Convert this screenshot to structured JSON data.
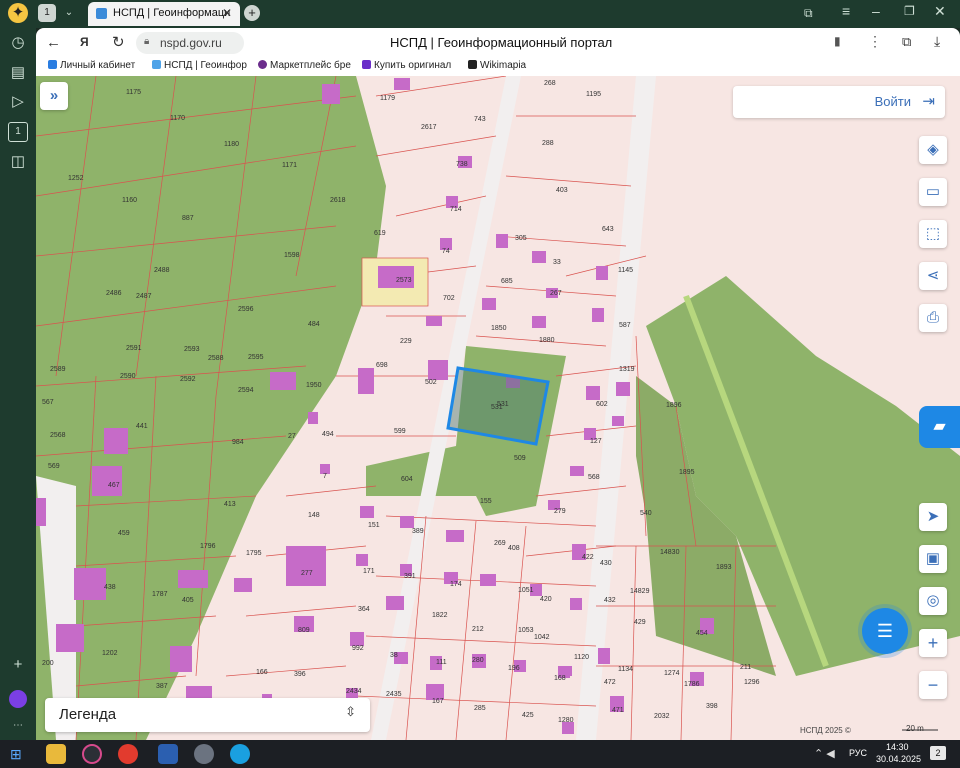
{
  "browser": {
    "tab_counter": "1",
    "tab_title": "НСПД | Геоинформаци",
    "url": "nspd.gov.ru",
    "page_title": "НСПД | Геоинформационный портал",
    "bookmarks": [
      "Личный кабинет",
      "НСПД | Геоинфор",
      "Маркетплейс бре",
      "Купить оригинал",
      "Wikimapia"
    ]
  },
  "map": {
    "login_label": "Войти",
    "legend_label": "Легенда",
    "attribution": "НСПД 2025 ©",
    "scale_label": "20 m",
    "selected_parcel": "531",
    "parcels": [
      "1175",
      "1179",
      "268",
      "1195",
      "1170",
      "2617",
      "743",
      "1180",
      "288",
      "1171",
      "738",
      "1252",
      "403",
      "1160",
      "2618",
      "714",
      "887",
      "619",
      "643",
      "305",
      "74",
      "33",
      "1145",
      "1598",
      "2488",
      "2573",
      "685",
      "267",
      "2486",
      "2487",
      "702",
      "2596",
      "484",
      "587",
      "1850",
      "229",
      "1880",
      "2591",
      "2593",
      "2588",
      "2595",
      "698",
      "502",
      "1319",
      "2589",
      "2590",
      "2592",
      "1950",
      "602",
      "1896",
      "2594",
      "567",
      "531",
      "441",
      "984",
      "27",
      "494",
      "599",
      "127",
      "2568",
      "569",
      "7",
      "509",
      "568",
      "1895",
      "467",
      "604",
      "155",
      "279",
      "540",
      "148",
      "151",
      "389",
      "459",
      "413",
      "1796",
      "1795",
      "269",
      "408",
      "422",
      "430",
      "14830",
      "1893",
      "277",
      "171",
      "391",
      "174",
      "1051",
      "420",
      "432",
      "14829",
      "438",
      "1787",
      "405",
      "364",
      "1822",
      "212",
      "1053",
      "1042",
      "429",
      "454",
      "809",
      "992",
      "38",
      "280",
      "1120",
      "1134",
      "1274",
      "211",
      "1202",
      "111",
      "196",
      "168",
      "472",
      "1786",
      "1296",
      "200",
      "166",
      "396",
      "2434",
      "2435",
      "167",
      "285",
      "425",
      "1280",
      "471",
      "2032",
      "398",
      "387"
    ],
    "colors": {
      "parcel_fill": "#f6e3e1",
      "parcel_stroke": "#d9534f",
      "forest": "#8fb36a",
      "building": "#c66bc8",
      "selected": "#1e88e5"
    }
  },
  "taskbar": {
    "time": "14:30",
    "date": "30.04.2025",
    "lang": "РУС",
    "notifications": "2"
  }
}
